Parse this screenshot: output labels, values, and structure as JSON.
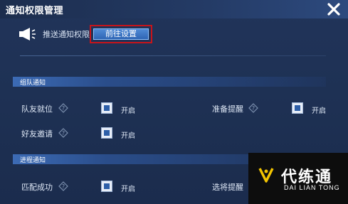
{
  "window": {
    "title": "通知权限管理"
  },
  "push": {
    "label": "推送通知权限",
    "goto_button": "前往设置"
  },
  "sections": [
    {
      "header": "组队通知"
    },
    {
      "header": "进程通知"
    }
  ],
  "options": {
    "teammate_ready": {
      "label": "队友就位",
      "state": "开启",
      "checked": true
    },
    "prepare_remind": {
      "label": "准备提醒",
      "state": "开启",
      "checked": true
    },
    "friend_invite": {
      "label": "好友邀请",
      "state": "开启",
      "checked": true
    },
    "match_success": {
      "label": "匹配成功",
      "state": "开启",
      "checked": true
    },
    "pick_remind": {
      "label": "选将提醒"
    }
  },
  "watermark": {
    "cn": "代练通",
    "en": "DAI LIAN TONG"
  },
  "colors": {
    "highlight_border": "#c8141a",
    "button_blue": "#2f65b4",
    "panel_bg": "#1e3154"
  }
}
